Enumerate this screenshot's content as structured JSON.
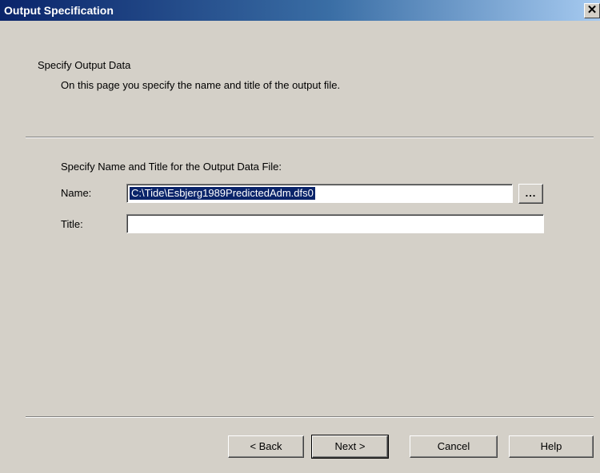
{
  "window": {
    "title": "Output Specification",
    "close_glyph": "✕"
  },
  "header": {
    "heading": "Specify Output Data",
    "description": "On this page you specify the name and title of the output file."
  },
  "form": {
    "group_label": "Specify Name and Title for the Output Data File:",
    "name_label": "Name:",
    "name_value": "C:\\Tide\\Esbjerg1989PredictedAdm.dfs0",
    "browse_label": "...",
    "title_label": "Title:",
    "title_value": ""
  },
  "buttons": {
    "back": "< Back",
    "next": "Next >",
    "cancel": "Cancel",
    "help": "Help"
  }
}
